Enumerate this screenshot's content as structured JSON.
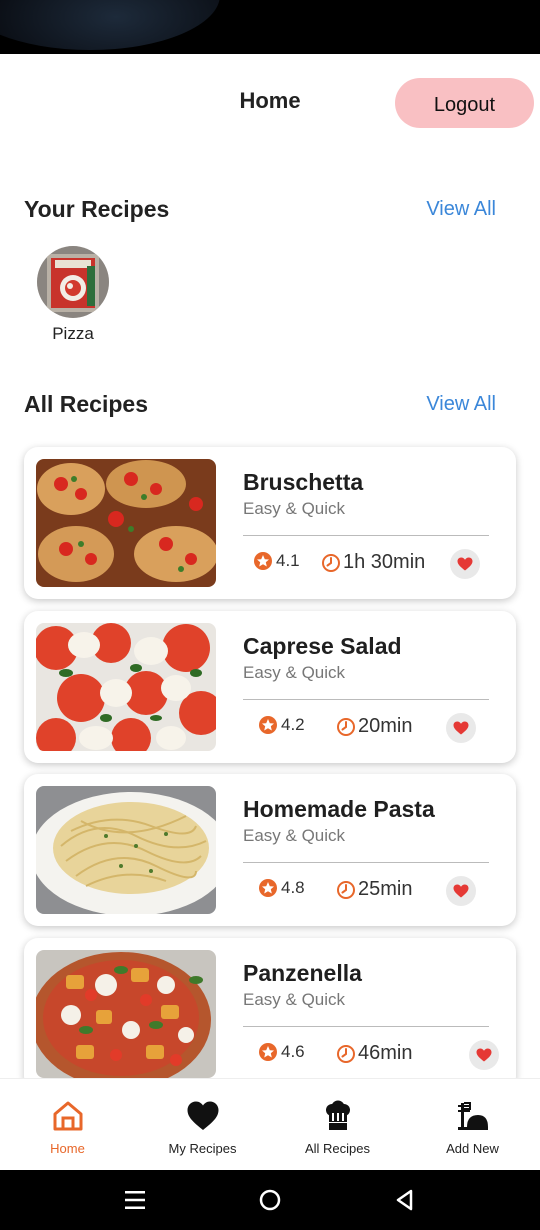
{
  "header": {
    "title": "Home",
    "logout_label": "Logout"
  },
  "your_recipes": {
    "title": "Your Recipes",
    "view_all": "View All",
    "items": [
      {
        "name": "Pizza"
      }
    ]
  },
  "all_recipes": {
    "title": "All Recipes",
    "view_all": "View All",
    "items": [
      {
        "name": "Bruschetta",
        "subtitle": "Easy & Quick",
        "rating": "4.1",
        "time": "1h 30min"
      },
      {
        "name": "Caprese Salad",
        "subtitle": "Easy & Quick",
        "rating": "4.2",
        "time": "20min"
      },
      {
        "name": "Homemade Pasta",
        "subtitle": "Easy & Quick",
        "rating": "4.8",
        "time": "25min"
      },
      {
        "name": "Panzenella",
        "subtitle": "Easy & Quick",
        "rating": "4.6",
        "time": "46min"
      }
    ]
  },
  "bottom_nav": {
    "items": [
      {
        "label": "Home",
        "icon": "home-icon",
        "active": true
      },
      {
        "label": "My Recipes",
        "icon": "heart-icon",
        "active": false
      },
      {
        "label": "All Recipes",
        "icon": "chef-hat-icon",
        "active": false
      },
      {
        "label": "Add New",
        "icon": "add-new-icon",
        "active": false
      }
    ]
  },
  "colors": {
    "accent": "#e8672a",
    "link": "#3b87d9",
    "logout_bg": "#f9c0c3",
    "heart": "#e53935"
  }
}
